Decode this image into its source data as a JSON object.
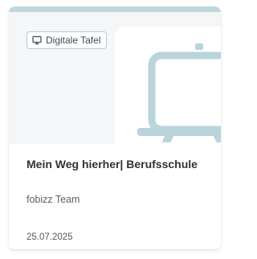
{
  "card": {
    "badge": {
      "label": "Digitale Tafel",
      "icon": "monitor-icon"
    },
    "illustration": {
      "icon": "whiteboard-icon"
    },
    "title": "Mein Weg hierher| Berufsschule",
    "author": "fobizz Team",
    "date": "25.07.2025"
  },
  "colors": {
    "top_strip": "#bfd6dc",
    "hero_background": "#f4f6f8",
    "illustration": "#b9d4db",
    "badge_border": "#b8c9cf",
    "title": "#2d3338",
    "text_muted": "#59636a"
  }
}
